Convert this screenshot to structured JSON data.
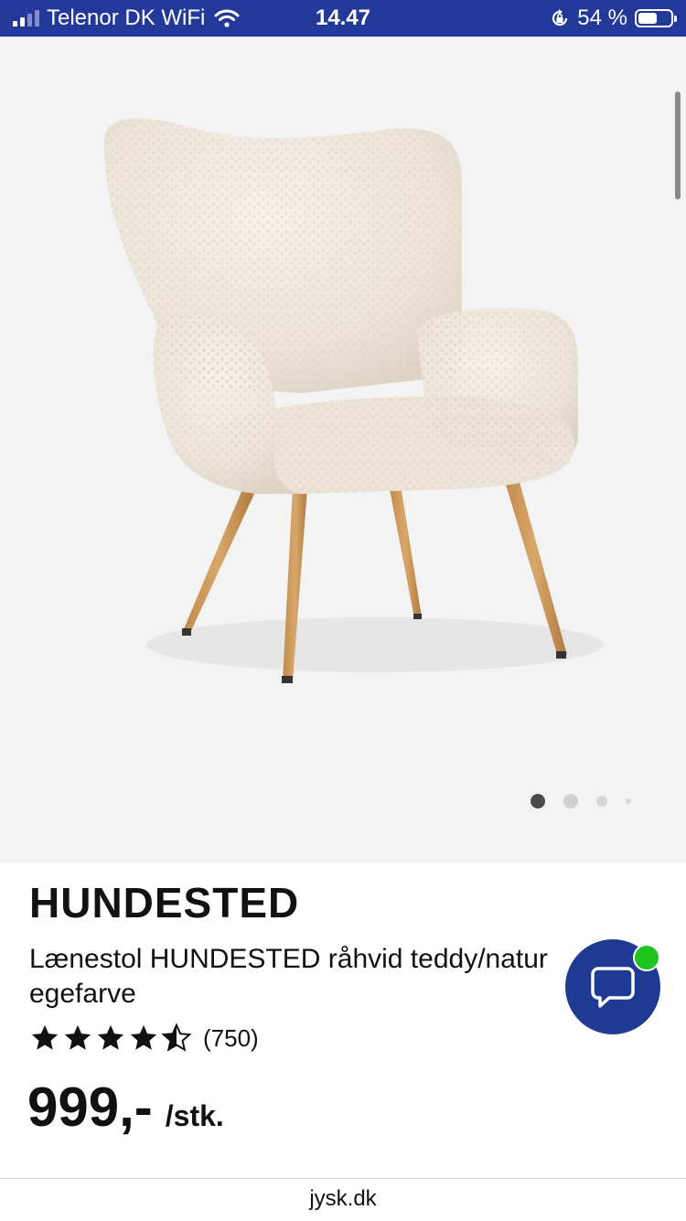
{
  "status_bar": {
    "carrier": "Telenor DK WiFi",
    "time": "14.47",
    "battery_percent": "54 %",
    "battery_level": 0.54,
    "signal_bars": 2,
    "icons": [
      "signal-icon",
      "wifi-icon",
      "rotation-lock-icon",
      "battery-icon"
    ]
  },
  "product": {
    "image_alt": "Lænestol HUNDESTED",
    "carousel": {
      "total": 4,
      "active": 1
    },
    "brand": "HUNDESTED",
    "description": "Lænestol HUNDESTED råhvid teddy/natur egefarve",
    "rating": {
      "stars": 4.5,
      "max": 5,
      "count_text": "(750)"
    },
    "price": "999,-",
    "unit": "/stk."
  },
  "chat": {
    "icon": "chat-bubble-icon",
    "status_color": "#1fc41f"
  },
  "browser": {
    "url": "jysk.dk"
  },
  "colors": {
    "status_bar_bg": "#22399a",
    "chat_bg": "#1f3a93",
    "hero_bg": "#f3f3f3"
  }
}
